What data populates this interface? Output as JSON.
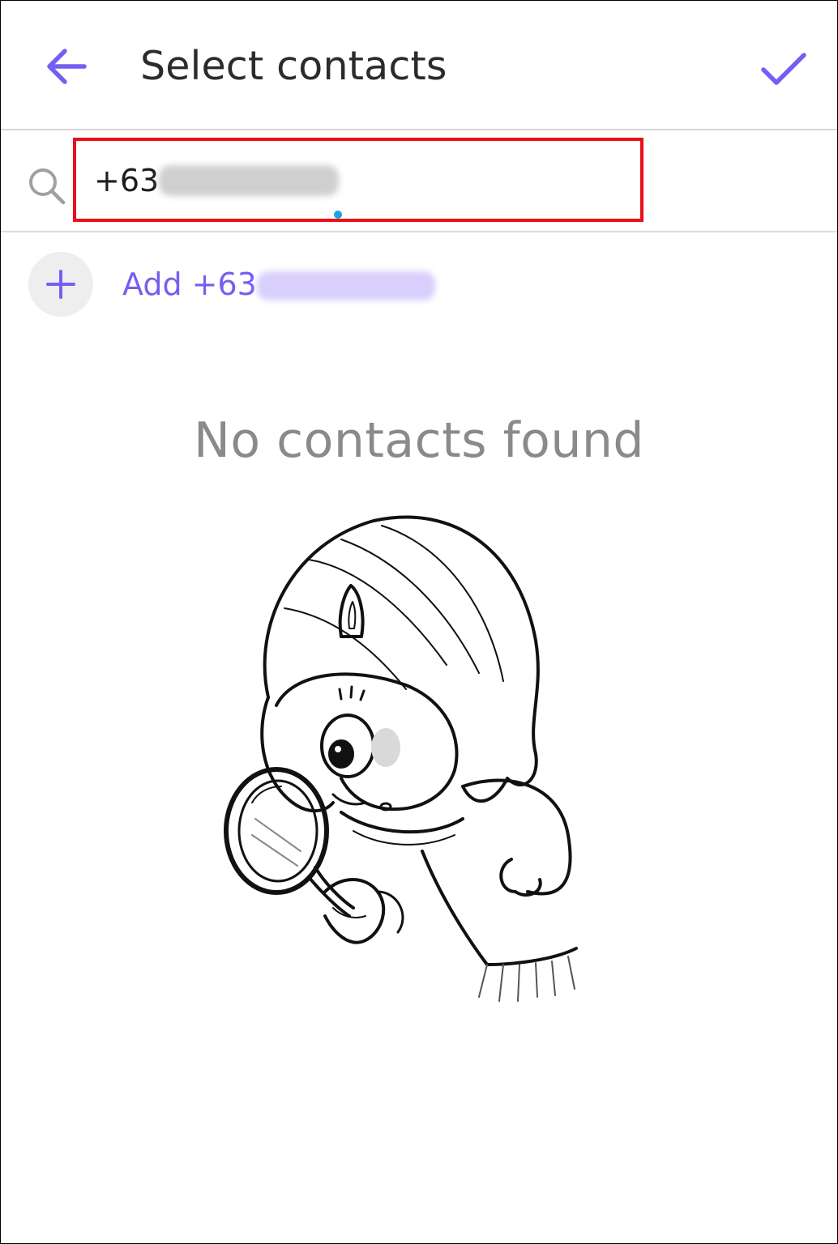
{
  "header": {
    "back_icon": "arrow-left-icon",
    "title": "Select contacts",
    "done_icon": "checkmark-icon"
  },
  "search": {
    "icon": "search-icon",
    "value": "+63",
    "placeholder": ""
  },
  "add_row": {
    "icon": "plus-icon",
    "label": "Add +63"
  },
  "empty_state": {
    "message": "No contacts found",
    "illustration": "girl-with-magnifying-glass"
  },
  "colors": {
    "accent": "#7360f2",
    "highlight_border": "#e8101a",
    "cursor": "#1ba4e6",
    "empty_text": "#8a8a8a"
  }
}
